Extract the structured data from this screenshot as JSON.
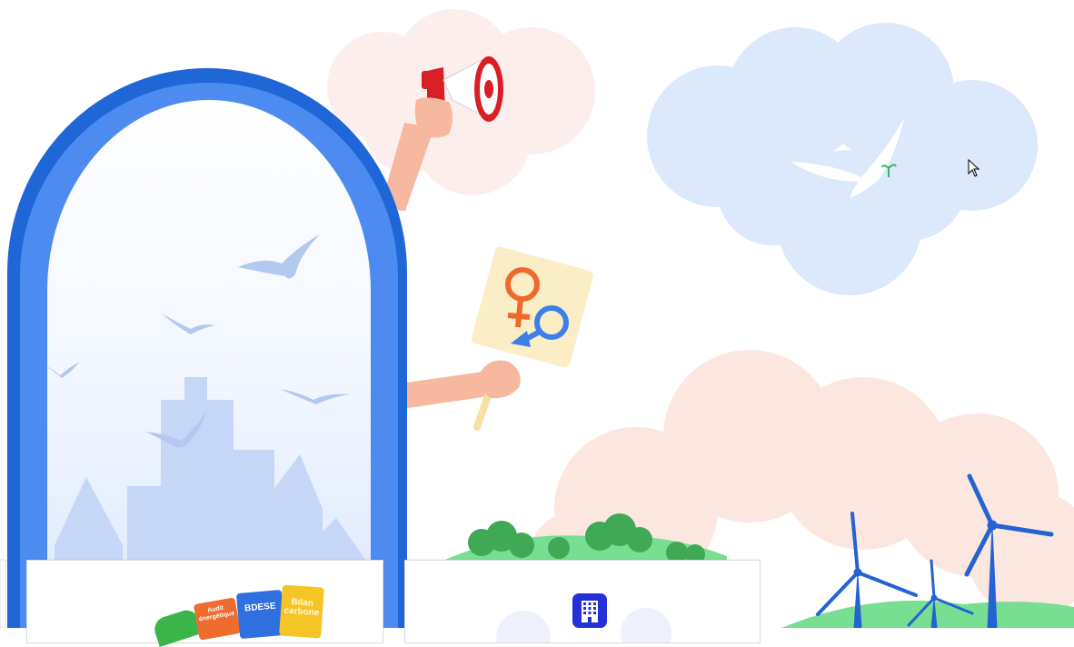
{
  "illustration": {
    "colors": {
      "arch_blue": "#1f66d6",
      "arch_inner_blue": "#4d8bf0",
      "cloud_pink": "#fdeeee",
      "cloud_blue": "#dce8fb",
      "cloud_peach": "#fbe7e0",
      "megaphone_red": "#d91f26",
      "skin": "#f6b9a0",
      "sign_yellow": "#fbedc6",
      "female_orange": "#ef6a2a",
      "male_blue": "#3e7ee8",
      "tree_green": "#3fa956",
      "hill_green": "#78de92",
      "turbine_blue": "#2463d1"
    },
    "icons": [
      "megaphone-icon",
      "gender-equality-sign-icon",
      "bird-icon",
      "wind-turbine-icon",
      "tree-icon",
      "city-skyline-icon"
    ]
  },
  "cards": [
    {
      "id": "left",
      "documents": [
        {
          "label": "Audit énergétique",
          "icon": "audit-doc-icon",
          "color": "#ef6c2f"
        },
        {
          "label": "BDESE",
          "icon": "bdese-doc-icon",
          "color": "#2f6fe0"
        },
        {
          "label": "Bilan carbone",
          "icon": "bilan-doc-icon",
          "color": "#f5c526"
        }
      ]
    },
    {
      "id": "right",
      "icon": "building-icon",
      "color": "#2431d6"
    }
  ]
}
